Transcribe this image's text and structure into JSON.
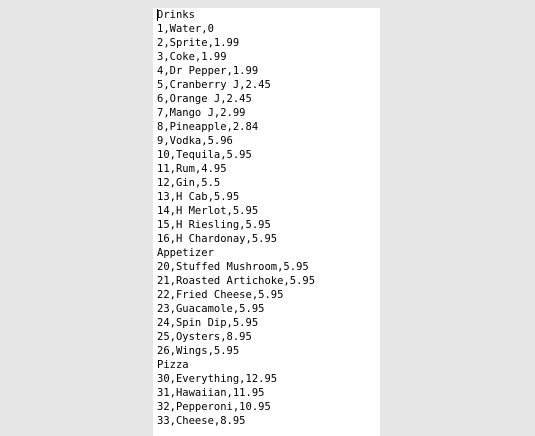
{
  "document": {
    "lines": [
      "Drinks",
      "1,Water,0",
      "2,Sprite,1.99",
      "3,Coke,1.99",
      "4,Dr Pepper,1.99",
      "5,Cranberry J,2.45",
      "6,Orange J,2.45",
      "7,Mango J,2.99",
      "8,Pineapple,2.84",
      "9,Vodka,5.96",
      "10,Tequila,5.95",
      "11,Rum,4.95",
      "12,Gin,5.5",
      "13,H Cab,5.95",
      "14,H Merlot,5.95",
      "15,H Riesling,5.95",
      "16,H Chardonay,5.95",
      "Appetizer",
      "20,Stuffed Mushroom,5.95",
      "21,Roasted Artichoke,5.95",
      "22,Fried Cheese,5.95",
      "23,Guacamole,5.95",
      "24,Spin Dip,5.95",
      "25,Oysters,8.95",
      "26,Wings,5.95",
      "Pizza",
      "30,Everything,12.95",
      "31,Hawaiian,11.95",
      "32,Pepperoni,10.95",
      "33,Cheese,8.95"
    ]
  }
}
